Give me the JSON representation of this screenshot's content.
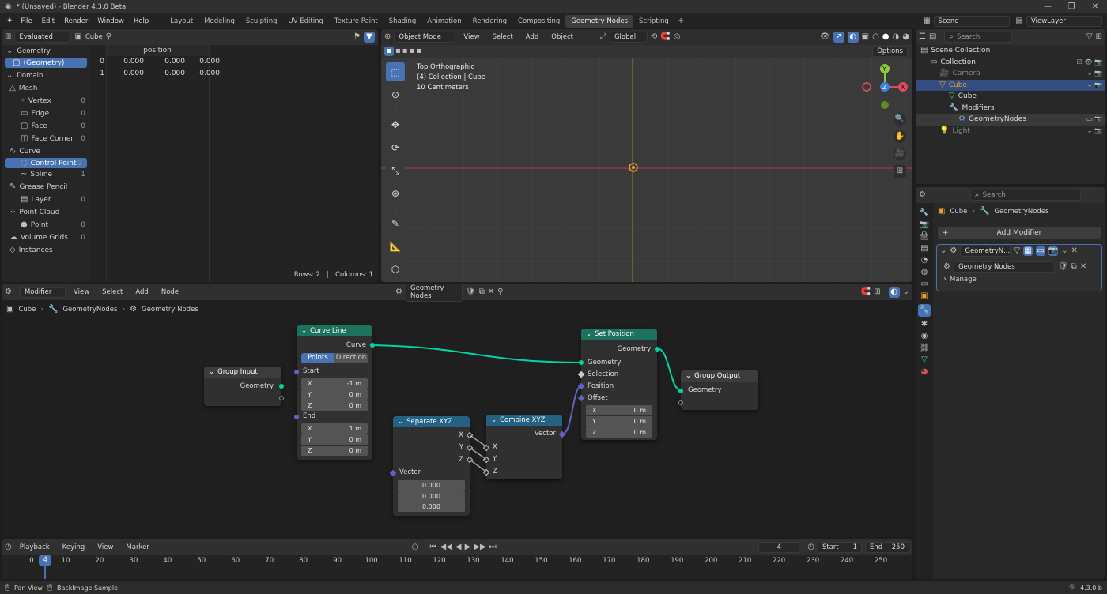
{
  "app": {
    "title": "* (Unsaved) - Blender 4.3.0 Beta",
    "menus": [
      "File",
      "Edit",
      "Render",
      "Window",
      "Help"
    ],
    "workspaces": [
      "Layout",
      "Modeling",
      "Sculpting",
      "UV Editing",
      "Texture Paint",
      "Shading",
      "Animation",
      "Rendering",
      "Compositing",
      "Geometry Nodes",
      "Scripting"
    ],
    "active_workspace": "Geometry Nodes",
    "scene": "Scene",
    "view_layer": "ViewLayer"
  },
  "spreadsheet": {
    "mode": "Evaluated",
    "object": "Cube",
    "sections": [
      "Geometry",
      "Domain"
    ],
    "geometry_item": "(Geometry)",
    "tree": [
      {
        "label": "Mesh",
        "count": ""
      },
      {
        "label": "Vertex",
        "count": "0"
      },
      {
        "label": "Edge",
        "count": "0"
      },
      {
        "label": "Face",
        "count": "0"
      },
      {
        "label": "Face Corner",
        "count": "0"
      },
      {
        "label": "Curve",
        "count": ""
      },
      {
        "label": "Control Point",
        "count": "2"
      },
      {
        "label": "Spline",
        "count": "1"
      },
      {
        "label": "Grease Pencil",
        "count": ""
      },
      {
        "label": "Layer",
        "count": "0"
      },
      {
        "label": "Point Cloud",
        "count": ""
      },
      {
        "label": "Point",
        "count": "0"
      },
      {
        "label": "Volume Grids",
        "count": "0"
      },
      {
        "label": "Instances",
        "count": ""
      }
    ],
    "column": "position",
    "rows": [
      [
        "0",
        "0.000",
        "0.000",
        "0.000"
      ],
      [
        "1",
        "0.000",
        "0.000",
        "0.000"
      ]
    ],
    "footer_rows": "Rows: 2",
    "footer_cols": "Columns: 1"
  },
  "viewport": {
    "mode": "Object Mode",
    "menus": [
      "View",
      "Select",
      "Add",
      "Object"
    ],
    "transform": "Global",
    "options": "Options",
    "overlay_lines": [
      "Top Orthographic",
      "(4) Collection | Cube",
      "10 Centimeters"
    ],
    "axes": {
      "x": "X",
      "y": "Y",
      "z": "Z"
    }
  },
  "outliner": {
    "search": "Search",
    "items": [
      {
        "label": "Scene Collection"
      },
      {
        "label": "Collection"
      },
      {
        "label": "Camera"
      },
      {
        "label": "Cube"
      },
      {
        "label": "Cube"
      },
      {
        "label": "Modifiers"
      },
      {
        "label": "GeometryNodes"
      },
      {
        "label": "Light"
      }
    ]
  },
  "properties": {
    "search": "Search",
    "object": "Cube",
    "modifier": "GeometryNodes",
    "add_modifier": "Add Modifier",
    "mod_name": "GeometryN...",
    "node_group": "Geometry Nodes",
    "manage": "Manage"
  },
  "node_editor": {
    "type": "Modifier",
    "menus": [
      "View",
      "Select",
      "Add",
      "Node"
    ],
    "node_group": "Geometry Nodes",
    "breadcrumb": [
      "Cube",
      "GeometryNodes",
      "Geometry Nodes"
    ],
    "nodes": {
      "group_input": {
        "title": "Group Input",
        "out": "Geometry"
      },
      "curve_line": {
        "title": "Curve Line",
        "out": "Curve",
        "mode_a": "Points",
        "mode_b": "Direction",
        "start": "Start",
        "end": "End",
        "start_vals": [
          [
            "X",
            "-1 m"
          ],
          [
            "Y",
            "0 m"
          ],
          [
            "Z",
            "0 m"
          ]
        ],
        "end_vals": [
          [
            "X",
            "1 m"
          ],
          [
            "Y",
            "0 m"
          ],
          [
            "Z",
            "0 m"
          ]
        ]
      },
      "separate_xyz": {
        "title": "Separate XYZ",
        "outs": [
          "X",
          "Y",
          "Z"
        ],
        "in": "Vector",
        "vals": [
          "0.000",
          "0.000",
          "0.000"
        ]
      },
      "combine_xyz": {
        "title": "Combine XYZ",
        "out": "Vector",
        "ins": [
          "X",
          "Y",
          "Z"
        ]
      },
      "set_position": {
        "title": "Set Position",
        "out": "Geometry",
        "ins": [
          "Geometry",
          "Selection",
          "Position",
          "Offset"
        ],
        "offset_vals": [
          [
            "X",
            "0 m"
          ],
          [
            "Y",
            "0 m"
          ],
          [
            "Z",
            "0 m"
          ]
        ]
      },
      "group_output": {
        "title": "Group Output",
        "in": "Geometry"
      }
    }
  },
  "timeline": {
    "menus": [
      "Playback",
      "Keying",
      "View",
      "Marker"
    ],
    "current": "4",
    "start_label": "Start",
    "start": "1",
    "end_label": "End",
    "end": "250",
    "ticks": [
      "0",
      "10",
      "20",
      "30",
      "40",
      "50",
      "60",
      "70",
      "80",
      "90",
      "100",
      "110",
      "120",
      "130",
      "140",
      "150",
      "160",
      "170",
      "180",
      "190",
      "200",
      "210",
      "220",
      "230",
      "240",
      "250"
    ]
  },
  "statusbar": {
    "left1": "Pan View",
    "left2": "BackImage Sample",
    "version": "4.3.0 b"
  },
  "colors": {
    "accent": "#4772b3",
    "geometry_socket": "#00d6a3",
    "vector_socket": "#6363c7",
    "node_geo_header": "#1d725e",
    "node_conv_header": "#246283"
  }
}
